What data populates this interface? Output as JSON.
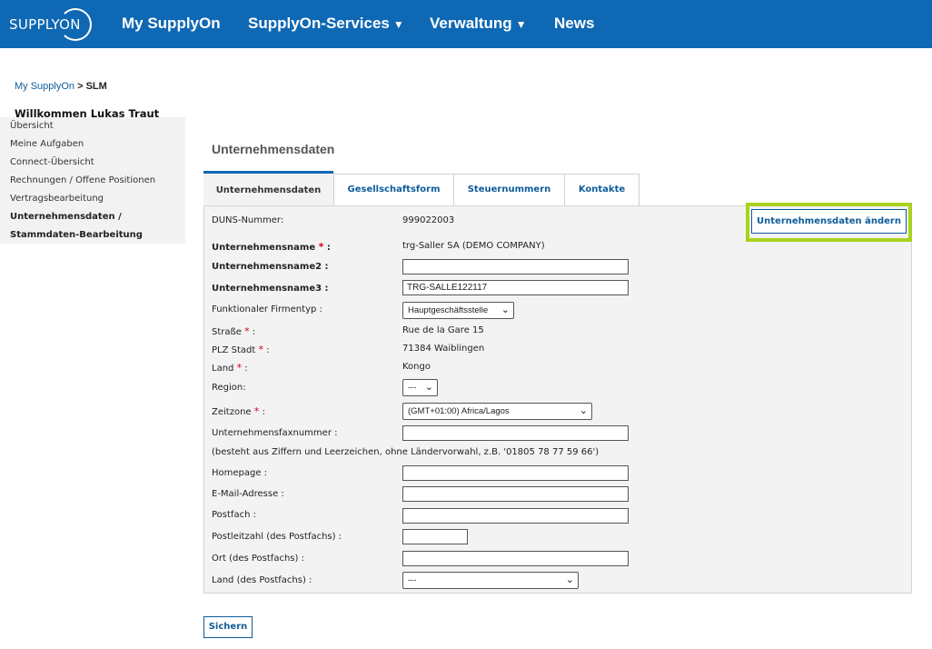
{
  "header": {
    "logo_text": "SUPPLYON",
    "nav": [
      {
        "label": "My SupplyOn"
      },
      {
        "label": "SupplyOn-Services"
      },
      {
        "label": "Verwaltung"
      },
      {
        "label": "News"
      }
    ]
  },
  "breadcrumb": {
    "home": "My SupplyOn",
    "separator": ">",
    "current": "SLM"
  },
  "welcome": "Willkommen Lukas Traut",
  "sidebar": {
    "items": [
      {
        "label": "Übersicht"
      },
      {
        "label": "Meine Aufgaben"
      },
      {
        "label": "Connect-Übersicht"
      },
      {
        "label": "Rechnungen / Offene Positionen"
      },
      {
        "label": "Vertragsbearbeitung"
      },
      {
        "label": "Unternehmensdaten /"
      },
      {
        "label": "Stammdaten-Bearbeitung"
      }
    ]
  },
  "page_title": "Unternehmensdaten",
  "tabs": [
    {
      "label": "Unternehmensdaten"
    },
    {
      "label": "Gesellschaftsform"
    },
    {
      "label": "Steuernummern"
    },
    {
      "label": "Kontakte"
    }
  ],
  "change_button": "Unternehmensdaten ändern",
  "required_mark": "*",
  "form": {
    "duns": {
      "label": "DUNS-Nummer:",
      "value": "999022003"
    },
    "name": {
      "label": "Unternehmensname",
      "suffix": ":",
      "value": "trg-Saller SA (DEMO COMPANY)"
    },
    "name2": {
      "label": "Unternehmensname2 :",
      "value": ""
    },
    "name3": {
      "label": "Unternehmensname3 :",
      "value": "TRG-SALLE122117"
    },
    "firmentyp": {
      "label": "Funktionaler Firmentyp :",
      "value": "Hauptgeschäftsstelle"
    },
    "strasse": {
      "label": "Straße",
      "suffix": ":",
      "value": "Rue de la Gare 15"
    },
    "plz_stadt": {
      "label": "PLZ Stadt",
      "suffix": ":",
      "value": "71384 Waiblingen"
    },
    "land": {
      "label": "Land",
      "suffix": ":",
      "value": "Kongo"
    },
    "region": {
      "label": "Region:",
      "value": "---"
    },
    "zeitzone": {
      "label": "Zeitzone",
      "suffix": ":",
      "value": "(GMT+01:00) Africa/Lagos"
    },
    "fax": {
      "label": "Unternehmensfaxnummer :",
      "value": ""
    },
    "fax_hint": "(besteht aus Ziffern und Leerzeichen, ohne Ländervorwahl, z.B. '01805 78 77 59 66')",
    "homepage": {
      "label": "Homepage :",
      "value": ""
    },
    "email": {
      "label": "E-Mail-Adresse :",
      "value": ""
    },
    "postfach": {
      "label": "Postfach :",
      "value": ""
    },
    "postfach_plz": {
      "label": "Postleitzahl (des Postfachs) :",
      "value": ""
    },
    "postfach_ort": {
      "label": "Ort (des Postfachs) :",
      "value": ""
    },
    "postfach_land": {
      "label": "Land (des Postfachs) :",
      "value": "---"
    }
  },
  "save_button": "Sichern",
  "colors": {
    "brand_blue": "#0f68b4",
    "link_blue": "#0f5c99",
    "highlight": "#a9d21b",
    "required": "#d0021b"
  }
}
